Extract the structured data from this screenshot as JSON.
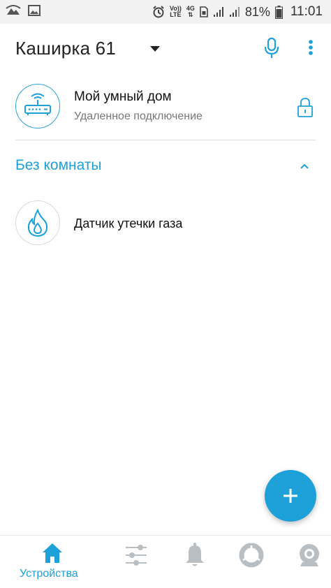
{
  "status_bar": {
    "volte_line1": "Vo))",
    "volte_line2": "LTE",
    "network_type": "4G",
    "battery_percent": "81%",
    "time": "11:01"
  },
  "header": {
    "home_name": "Каширка 61"
  },
  "hub": {
    "name": "Мой умный дом",
    "status": "Удаленное подключение"
  },
  "room": {
    "title": "Без комнаты",
    "devices": [
      {
        "name": "Датчик утечки газа",
        "icon": "flame-icon"
      }
    ]
  },
  "bottom_nav": {
    "active": "devices",
    "items": [
      {
        "id": "devices",
        "label": "Устройства",
        "icon": "home-icon"
      },
      {
        "id": "scenarios",
        "label": "",
        "icon": "sliders-icon"
      },
      {
        "id": "notifications",
        "label": "",
        "icon": "bell-icon"
      },
      {
        "id": "security",
        "label": "",
        "icon": "shield-ring-icon"
      },
      {
        "id": "cameras",
        "label": "",
        "icon": "camera-icon"
      }
    ]
  },
  "colors": {
    "accent": "#1ea0d9",
    "inactive_icon": "#b9bec2",
    "text_primary": "#111111",
    "text_secondary": "#777777"
  }
}
